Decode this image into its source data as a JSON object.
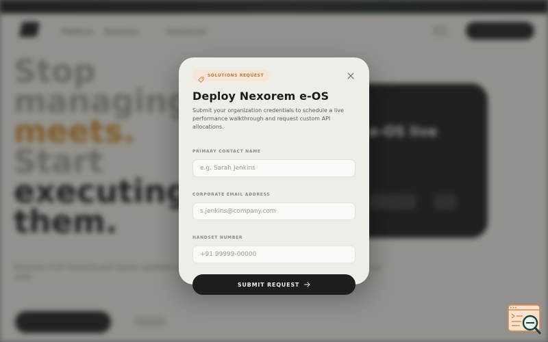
{
  "background": {
    "nav_links": [
      "Platform",
      "Solutions",
      "Enterprise"
    ],
    "hero_lines": [
      "Stop",
      "managing",
      "meets.",
      "Start",
      "executing",
      "them."
    ],
    "subtext": "Nexorem e-OS connects your teams, pipelines and approvals into one operating layer built for execution at scale.",
    "card_title": "e-OS live"
  },
  "modal": {
    "badge": "SOLUTIONS REQUEST",
    "title": "Deploy Nexorem e-OS",
    "description": "Submit your organization credentials to schedule a live performance walkthrough and request custom API allocations.",
    "fields": {
      "contact": {
        "label": "PRIMARY CONTACT NAME",
        "placeholder": "e.g. Sarah Jenkins",
        "value": ""
      },
      "email": {
        "label": "CORPORATE EMAIL ADDRESS",
        "placeholder": "s.jenkins@company.com",
        "value": ""
      },
      "phone": {
        "label": "HANDSET NUMBER",
        "placeholder": "+91 99999-00000",
        "value": ""
      }
    },
    "submit_label": "SUBMIT REQUEST"
  },
  "colors": {
    "accent": "#c8862e",
    "badge_bg": "#f4e5d6",
    "button_bg": "#1e1d1b",
    "modal_bg": "#efede8"
  },
  "icons": {
    "badge": "tag-icon",
    "close": "close-icon",
    "submit": "arrow-right-icon",
    "corner": "search-console-icon"
  }
}
